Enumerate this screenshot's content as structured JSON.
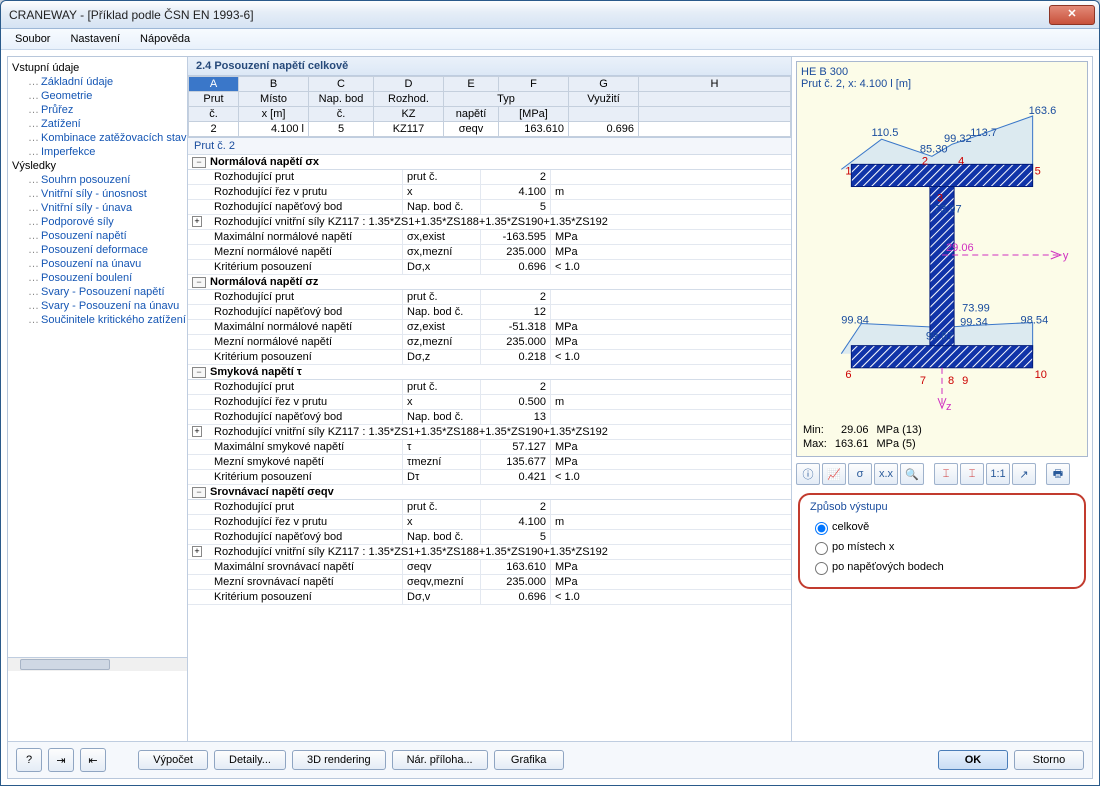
{
  "window": {
    "title": "CRANEWAY - [Příklad podle ČSN EN 1993-6]"
  },
  "menu": {
    "soubor": "Soubor",
    "nastaveni": "Nastavení",
    "napoveda": "Nápověda"
  },
  "tree": {
    "grp1": "Vstupní údaje",
    "items1": [
      "Základní údaje",
      "Geometrie",
      "Průřez",
      "Zatížení",
      "Kombinace zatěžovacích stavů",
      "Imperfekce"
    ],
    "grp2": "Výsledky",
    "items2": [
      "Souhrn posouzení",
      "Vnitřní síly - únosnost",
      "Vnitřní síly - únava",
      "Podporové síly",
      "Posouzení napětí",
      "Posouzení deformace",
      "Posouzení na únavu",
      "Posouzení boulení",
      "Svary - Posouzení napětí",
      "Svary - Posouzení na únavu",
      "Součinitele kritického zatížení"
    ]
  },
  "panel": {
    "title": "2.4 Posouzení napětí celkově"
  },
  "gridhdr": {
    "letters": [
      "A",
      "B",
      "C",
      "D",
      "E",
      "F",
      "G",
      "H"
    ],
    "r1": [
      "Prut",
      "Místo",
      "Nap. bod",
      "Rozhod.",
      "Typ",
      "",
      "Využití",
      ""
    ],
    "r2": [
      "č.",
      "x [m]",
      "č.",
      "KZ",
      "napětí",
      "[MPa]",
      "",
      ""
    ],
    "row": [
      "2",
      "4.100 l",
      "5",
      "KZ117",
      "σeqv",
      "163.610",
      "0.696",
      ""
    ]
  },
  "detail": {
    "hdr": "Prut č.  2",
    "s1": {
      "title": "Normálová napětí σx",
      "rows": [
        [
          "Rozhodující prut",
          "prut č.",
          "2",
          ""
        ],
        [
          "Rozhodující řez v prutu",
          "x",
          "4.100",
          "m"
        ],
        [
          "Rozhodující napěťový bod",
          "Nap. bod č.",
          "5",
          ""
        ]
      ],
      "exp": "Rozhodující vnitřní síly KZ117 : 1.35*ZS1+1.35*ZS188+1.35*ZS190+1.35*ZS192",
      "rows2": [
        [
          "Maximální normálové napětí",
          "σx,exist",
          "-163.595",
          "MPa"
        ],
        [
          "Mezní normálové napětí",
          "σx,mezní",
          "235.000",
          "MPa"
        ],
        [
          "Kritérium posouzení",
          "Dσ,x",
          "0.696",
          "< 1.0"
        ]
      ]
    },
    "s2": {
      "title": "Normálová napětí σz",
      "rows": [
        [
          "Rozhodující prut",
          "prut č.",
          "2",
          ""
        ],
        [
          "Rozhodující napěťový bod",
          "Nap. bod č.",
          "12",
          ""
        ],
        [
          "Maximální normálové napětí",
          "σz,exist",
          "-51.318",
          "MPa"
        ],
        [
          "Mezní normálové napětí",
          "σz,mezní",
          "235.000",
          "MPa"
        ],
        [
          "Kritérium posouzení",
          "Dσ,z",
          "0.218",
          "< 1.0"
        ]
      ]
    },
    "s3": {
      "title": "Smyková napětí τ",
      "rows": [
        [
          "Rozhodující prut",
          "prut č.",
          "2",
          ""
        ],
        [
          "Rozhodující řez v prutu",
          "x",
          "0.500",
          "m"
        ],
        [
          "Rozhodující napěťový bod",
          "Nap. bod č.",
          "13",
          ""
        ]
      ],
      "exp": "Rozhodující vnitřní síly KZ117 : 1.35*ZS1+1.35*ZS188+1.35*ZS190+1.35*ZS192",
      "rows2": [
        [
          "Maximální smykové napětí",
          "τ",
          "57.127",
          "MPa"
        ],
        [
          "Mezní smykové napětí",
          "τmezní",
          "135.677",
          "MPa"
        ],
        [
          "Kritérium posouzení",
          "Dτ",
          "0.421",
          "< 1.0"
        ]
      ]
    },
    "s4": {
      "title": "Srovnávací napětí σeqv",
      "rows": [
        [
          "Rozhodující prut",
          "prut č.",
          "2",
          ""
        ],
        [
          "Rozhodující řez v prutu",
          "x",
          "4.100",
          "m"
        ],
        [
          "Rozhodující napěťový bod",
          "Nap. bod č.",
          "5",
          ""
        ]
      ],
      "exp": "Rozhodující vnitřní síly KZ117 : 1.35*ZS1+1.35*ZS188+1.35*ZS190+1.35*ZS192",
      "rows2": [
        [
          "Maximální srovnávací napětí",
          "σeqv",
          "163.610",
          "MPa"
        ],
        [
          "Mezní srovnávací napětí",
          "σeqv,mezní",
          "235.000",
          "MPa"
        ],
        [
          "Kritérium posouzení",
          "Dσ,v",
          "0.696",
          "< 1.0"
        ]
      ]
    }
  },
  "diagram": {
    "title1": "HE B 300",
    "title2": "Prut č. 2, x: 4.100 l [m]",
    "pts": {
      "1": "1",
      "2": "2",
      "3": "3",
      "4": "4",
      "5": "5",
      "6": "6",
      "7": "7",
      "8": "8",
      "9": "9",
      "10": "10"
    },
    "vals": {
      "v1": "110.5",
      "v2": "85.30",
      "v3": "99.32",
      "v4": "113.7",
      "v5": "163.6",
      "v6": "73.97",
      "v7": "29.06",
      "v8": "99.84",
      "v9": "99.57",
      "v10": "99.34",
      "v11": "98.54",
      "v12": "73.99"
    },
    "axes": {
      "y": "y",
      "z": "z"
    },
    "min_l": "Min:",
    "min_v": "29.06",
    "min_u": "MPa (13)",
    "max_l": "Max:",
    "max_v": "163.61",
    "max_u": "MPa (5)"
  },
  "opts": {
    "cap": "Způsob výstupu",
    "o1": "celkově",
    "o2": "po místech x",
    "o3": "po napěťových bodech"
  },
  "footer": {
    "vypocet": "Výpočet",
    "detaily": "Detaily...",
    "render": "3D rendering",
    "priloha": "Nár. příloha...",
    "grafika": "Grafika",
    "ok": "OK",
    "storno": "Storno"
  }
}
